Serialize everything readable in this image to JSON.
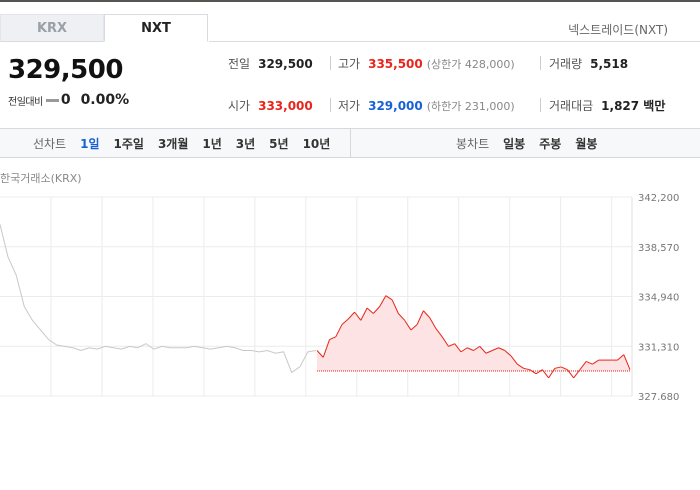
{
  "tabs": [
    {
      "label": "KRX",
      "active": false
    },
    {
      "label": "NXT",
      "active": true
    }
  ],
  "venue_link": "넥스트레이드(NXT)",
  "quote": {
    "price": "329,500",
    "change_label": "전일대비",
    "change_value": "0",
    "change_pct": "0.00%"
  },
  "stats": {
    "prev_close": {
      "label": "전일",
      "value": "329,500"
    },
    "high": {
      "label": "고가",
      "value": "335,500",
      "sub": "(상한가 428,000)"
    },
    "volume": {
      "label": "거래량",
      "value": "5,518"
    },
    "open": {
      "label": "시가",
      "value": "333,000"
    },
    "low": {
      "label": "저가",
      "value": "329,000",
      "sub": "(하한가 231,000)"
    },
    "amount": {
      "label": "거래대금",
      "value": "1,827 백만"
    }
  },
  "period_bar": {
    "line_title": "선차트",
    "line_options": [
      "1일",
      "1주일",
      "3개월",
      "1년",
      "3년",
      "5년",
      "10년"
    ],
    "line_selected": 0,
    "candle_title": "봉차트",
    "candle_options": [
      "일봉",
      "주봉",
      "월봉"
    ]
  },
  "chart_source": "한국거래소(KRX)",
  "colors": {
    "up": "#e8251a",
    "down": "#1761d6",
    "flat": "#999999",
    "fill_up": "#fde3e3",
    "pre_line": "#c8c8c8"
  },
  "chart_data": {
    "type": "line",
    "y_ticks": [
      "342,200",
      "338,570",
      "334,940",
      "331,310",
      "327,680"
    ],
    "ylim": [
      327680,
      342200
    ],
    "baseline": 329500,
    "segments": [
      {
        "name": "",
        "values": [
          340200,
          337800,
          336500,
          334200,
          333200,
          332500,
          331800,
          331400,
          331300,
          331200,
          331000,
          331200,
          331100,
          331300,
          331200,
          331100,
          331300,
          331200,
          331500,
          331100,
          331300,
          331200,
          331200,
          331200,
          331300,
          331200,
          331100,
          331200,
          331300,
          331200,
          331000,
          331000,
          330900,
          331000,
          330800,
          330900,
          329400,
          329800,
          330900,
          331000
        ]
      },
      {
        "name": "",
        "values": [
          331000,
          330500,
          331800,
          332000,
          332900,
          333300,
          333800,
          333200,
          334100,
          333700,
          334200,
          335000,
          334700,
          333700,
          333200,
          332500,
          332900,
          333900,
          333400,
          332600,
          332000,
          331300,
          331500,
          330900,
          331200,
          331000,
          331300,
          330800,
          331000,
          331200,
          331000,
          330600,
          330000,
          329700,
          329600,
          329300,
          329600,
          329000,
          329700,
          329800,
          329600,
          329000,
          329600,
          330200,
          330000,
          330300,
          330300,
          330300,
          330300,
          330700,
          329600
        ]
      }
    ]
  }
}
